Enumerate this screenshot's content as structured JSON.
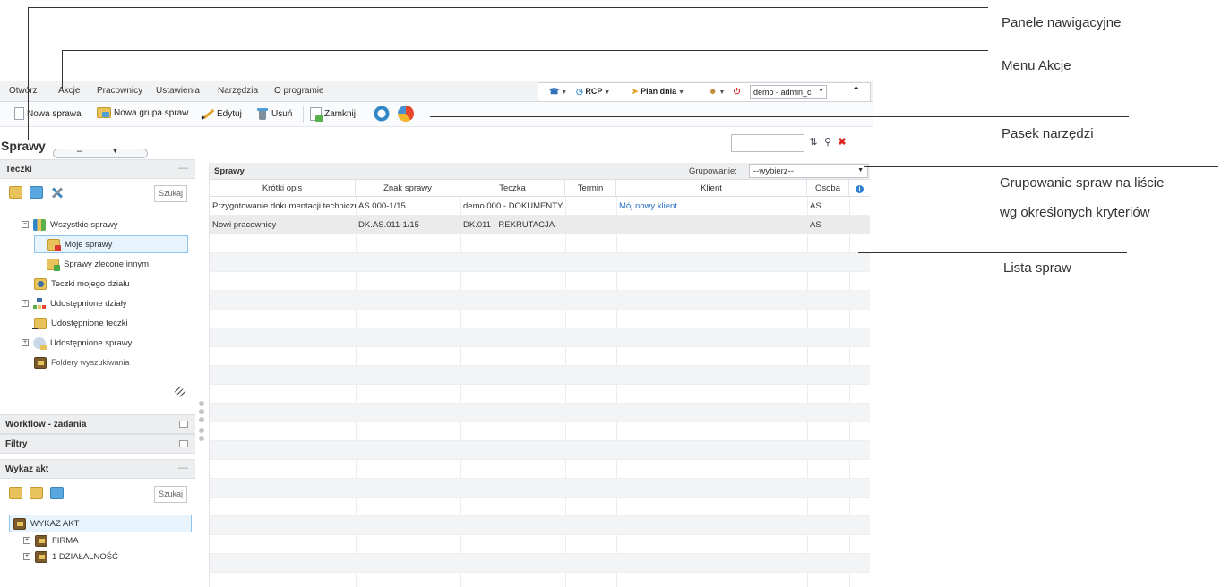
{
  "menu": [
    "Otwórz",
    "Akcje",
    "Pracownicy",
    "Ustawienia",
    "Narzędzia",
    "O programie"
  ],
  "top_tools": {
    "rcp": "RCP",
    "plan": "Plan dnia",
    "user": "demo - admin_c"
  },
  "toolbar": {
    "new_case": "Nowa sprawa",
    "new_group": "Nowa grupa spraw",
    "edit": "Edytuj",
    "delete": "Usuń",
    "close": "Zamknij"
  },
  "page_title": "Sprawy",
  "left": {
    "teczki_title": "Teczki",
    "search_btn": "Szukaj",
    "tree": [
      "Wszystkie sprawy",
      "Moje sprawy",
      "Sprawy zlecone innym",
      "Teczki mojego działu",
      "Udostępnione działy",
      "Udostępnione teczki",
      "Udostępnione sprawy",
      "Foldery wyszukiwania"
    ],
    "workflow_title": "Workflow - zadania",
    "filtry_title": "Filtry",
    "wykaz_title": "Wykaz akt",
    "wykaz_search": "Szukaj",
    "wykaz_tree": [
      "WYKAZ AKT",
      "FIRMA",
      "1 DZIAŁALNOŚĆ"
    ]
  },
  "grid": {
    "title": "Sprawy",
    "grouping_label": "Grupowanie:",
    "grouping_value": "--wybierz--",
    "columns": [
      "Krótki opis",
      "Znak sprawy",
      "Teczka",
      "Termin",
      "Klient",
      "Osoba"
    ],
    "rows": [
      [
        "Przygotowanie dokumentacji technicznej",
        "AS.000-1/15",
        "demo.000 - DOKUMENTY",
        "",
        "Mój nowy klient",
        "AS"
      ],
      [
        "Nowi pracownicy",
        "DK.AS.011-1/15",
        "DK.011 - REKRUTACJA",
        "",
        "",
        "AS"
      ]
    ]
  },
  "callouts": {
    "panele": "Panele nawigacyjne",
    "menu": "Menu Akcje",
    "pasek": "Pasek narzędzi",
    "grup1": "Grupowanie spraw na liście",
    "grup2": "wg określonych kryteriów",
    "lista": "Lista spraw"
  }
}
